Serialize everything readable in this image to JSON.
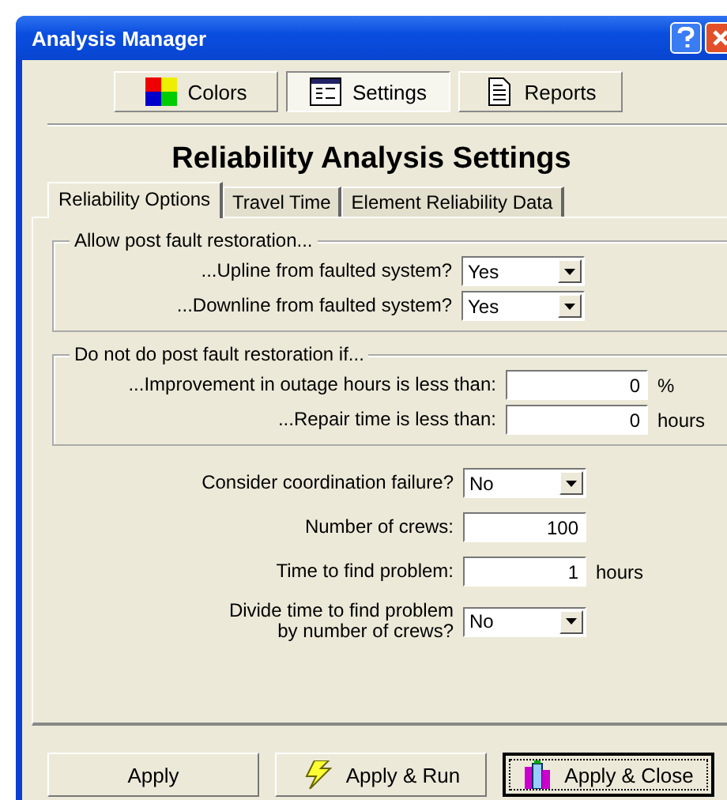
{
  "window": {
    "title": "Analysis Manager"
  },
  "toolbar": [
    {
      "label": "Colors",
      "selected": false
    },
    {
      "label": "Settings",
      "selected": true
    },
    {
      "label": "Reports",
      "selected": false
    }
  ],
  "heading": "Reliability Analysis Settings",
  "tabs": [
    {
      "label": "Reliability Options",
      "selected": true
    },
    {
      "label": "Travel Time",
      "selected": false
    },
    {
      "label": "Element Reliability Data",
      "selected": false
    }
  ],
  "groups": [
    {
      "title": "Allow post fault restoration...",
      "rows": [
        {
          "kind": "dropdown",
          "label": "...Upline from faulted system?",
          "value": "Yes"
        },
        {
          "kind": "dropdown",
          "label": "...Downline from faulted system?",
          "value": "Yes"
        }
      ]
    },
    {
      "title": "Do not do post fault restoration if...",
      "rows": [
        {
          "kind": "number",
          "label": "...Improvement in outage hours is less than:",
          "value": "0",
          "unit": "%"
        },
        {
          "kind": "number",
          "label": "...Repair time is less than:",
          "value": "0",
          "unit": "hours"
        }
      ]
    }
  ],
  "rows": [
    {
      "kind": "dropdown",
      "label": "Consider coordination failure?",
      "value": "No"
    },
    {
      "kind": "number",
      "label": "Number of crews:",
      "value": "100"
    },
    {
      "kind": "number",
      "label": "Time to find problem:",
      "value": "1",
      "unit": "hours"
    },
    {
      "kind": "dropdown",
      "label": "Divide time to find problem\nby number of crews?",
      "value": "No"
    }
  ],
  "buttons": [
    {
      "label": "Apply",
      "focused": false
    },
    {
      "label": "Apply & Run",
      "focused": false
    },
    {
      "label": "Apply & Close",
      "focused": true
    }
  ]
}
